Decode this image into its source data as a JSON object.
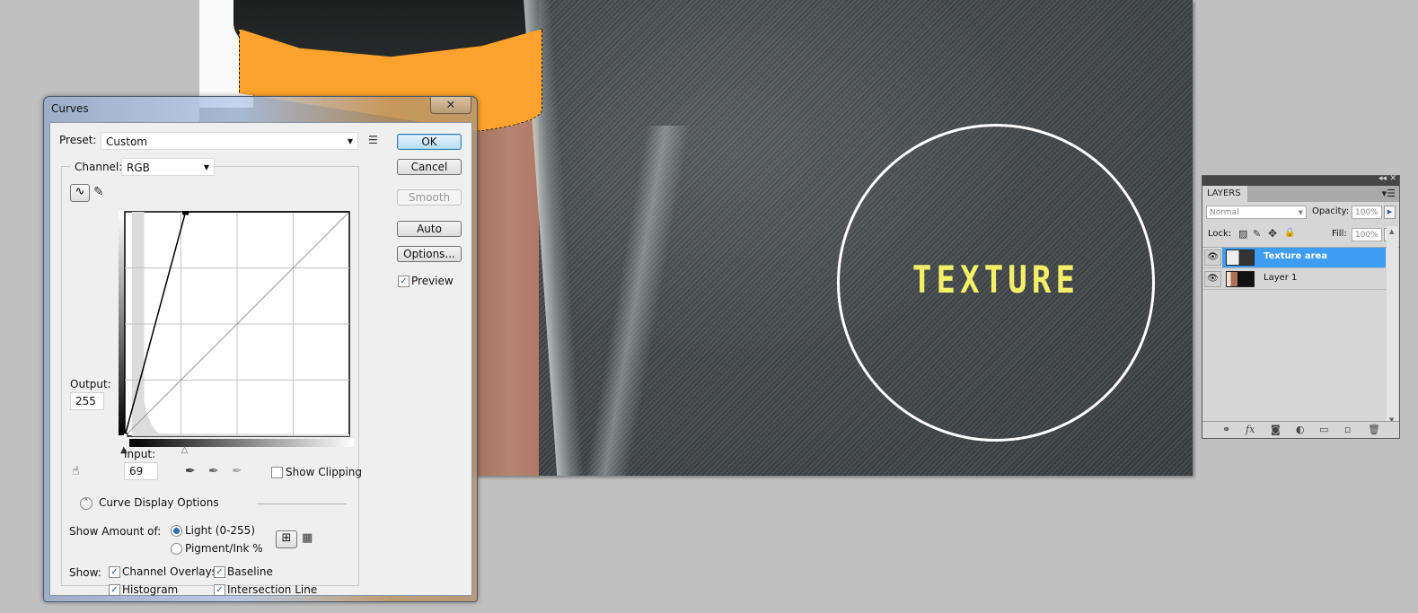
{
  "canvas": {
    "overlay_text": "TEXTURE",
    "colors": {
      "selection_fill": "#fda22d",
      "text": "#f5ef68",
      "circle": "#ffffff"
    }
  },
  "curves_dialog": {
    "title": "Curves",
    "close_label": "✕",
    "preset": {
      "label": "Preset:",
      "value": "Custom"
    },
    "channel": {
      "label": "Channel:",
      "value": "RGB"
    },
    "buttons": {
      "ok": "OK",
      "cancel": "Cancel",
      "smooth": "Smooth",
      "auto": "Auto",
      "options": "Options..."
    },
    "preview": {
      "label": "Preview",
      "checked": true
    },
    "output": {
      "label": "Output:",
      "value": "255"
    },
    "input": {
      "label": "Input:",
      "value": "69"
    },
    "show_clipping": {
      "label": "Show Clipping",
      "checked": false
    },
    "curve_display_options": "Curve Display Options",
    "show_amount_of": {
      "label": "Show Amount of:",
      "options": [
        {
          "label": "Light  (0-255)",
          "selected": true
        },
        {
          "label": "Pigment/Ink %",
          "selected": false
        }
      ]
    },
    "show": {
      "label": "Show:",
      "options": [
        {
          "label": "Channel Overlays",
          "checked": true
        },
        {
          "label": "Baseline",
          "checked": true
        },
        {
          "label": "Histogram",
          "checked": true
        },
        {
          "label": "Intersection Line",
          "checked": true
        }
      ]
    },
    "curve": {
      "points": [
        [
          0,
          0
        ],
        [
          69,
          255
        ]
      ],
      "range": [
        0,
        255
      ],
      "grid_divisions": 4,
      "histogram_peak_input_range": [
        8,
        22
      ]
    },
    "icons": {
      "curve_tool": "curve-point-icon",
      "pencil_tool": "pencil-icon",
      "target_adjust": "hand-adjust-icon",
      "eyedroppers": [
        "black-eyedropper-icon",
        "gray-eyedropper-icon",
        "white-eyedropper-icon"
      ],
      "preset_menu": "preset-options-icon",
      "grid_simple": "grid-4-icon",
      "grid_detailed": "grid-10-icon"
    }
  },
  "layers_panel": {
    "tab": "LAYERS",
    "blend_mode": "Normal",
    "opacity": {
      "label": "Opacity:",
      "value": "100%"
    },
    "lock_label": "Lock:",
    "fill": {
      "label": "Fill:",
      "value": "100%"
    },
    "layers": [
      {
        "name": "Texture area",
        "selected": true,
        "visible": true
      },
      {
        "name": "Layer 1",
        "selected": false,
        "visible": true
      }
    ],
    "selection_color": "#3d9df3"
  }
}
